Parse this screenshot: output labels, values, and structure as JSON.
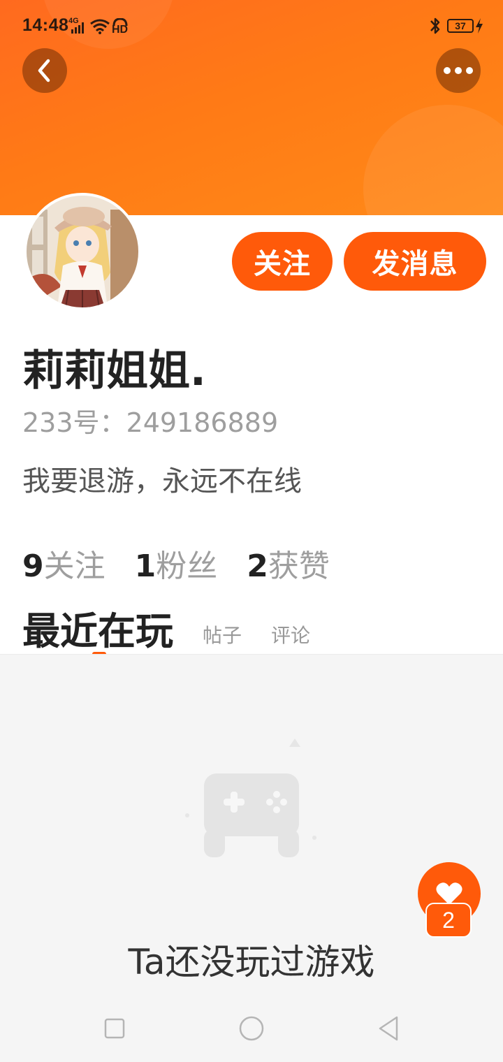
{
  "status_bar": {
    "time": "14:48",
    "network": "4G",
    "hd": "HD",
    "battery": "37"
  },
  "header": {
    "back_icon": "chevron-left-icon",
    "more_icon": "more-dots-icon"
  },
  "actions": {
    "follow_label": "关注",
    "message_label": "发消息"
  },
  "profile": {
    "name": "莉莉姐姐.",
    "id_text": "233号：249186889",
    "bio": "我要退游，永远不在线"
  },
  "stats": [
    {
      "num": "9",
      "label": "关注"
    },
    {
      "num": "1",
      "label": "粉丝"
    },
    {
      "num": "2",
      "label": "获赞"
    }
  ],
  "tabs": {
    "active": "最近在玩",
    "posts": "帖子",
    "comments": "评论"
  },
  "empty_state": {
    "text": "Ta还没玩过游戏",
    "icon": "gamepad-icon"
  },
  "like": {
    "icon": "heart-icon",
    "count": "2"
  },
  "colors": {
    "accent": "#ff5a0a",
    "banner": "#ff7a16"
  },
  "nav": {
    "recent_icon": "square-icon",
    "home_icon": "circle-icon",
    "back_icon": "triangle-back-icon"
  }
}
